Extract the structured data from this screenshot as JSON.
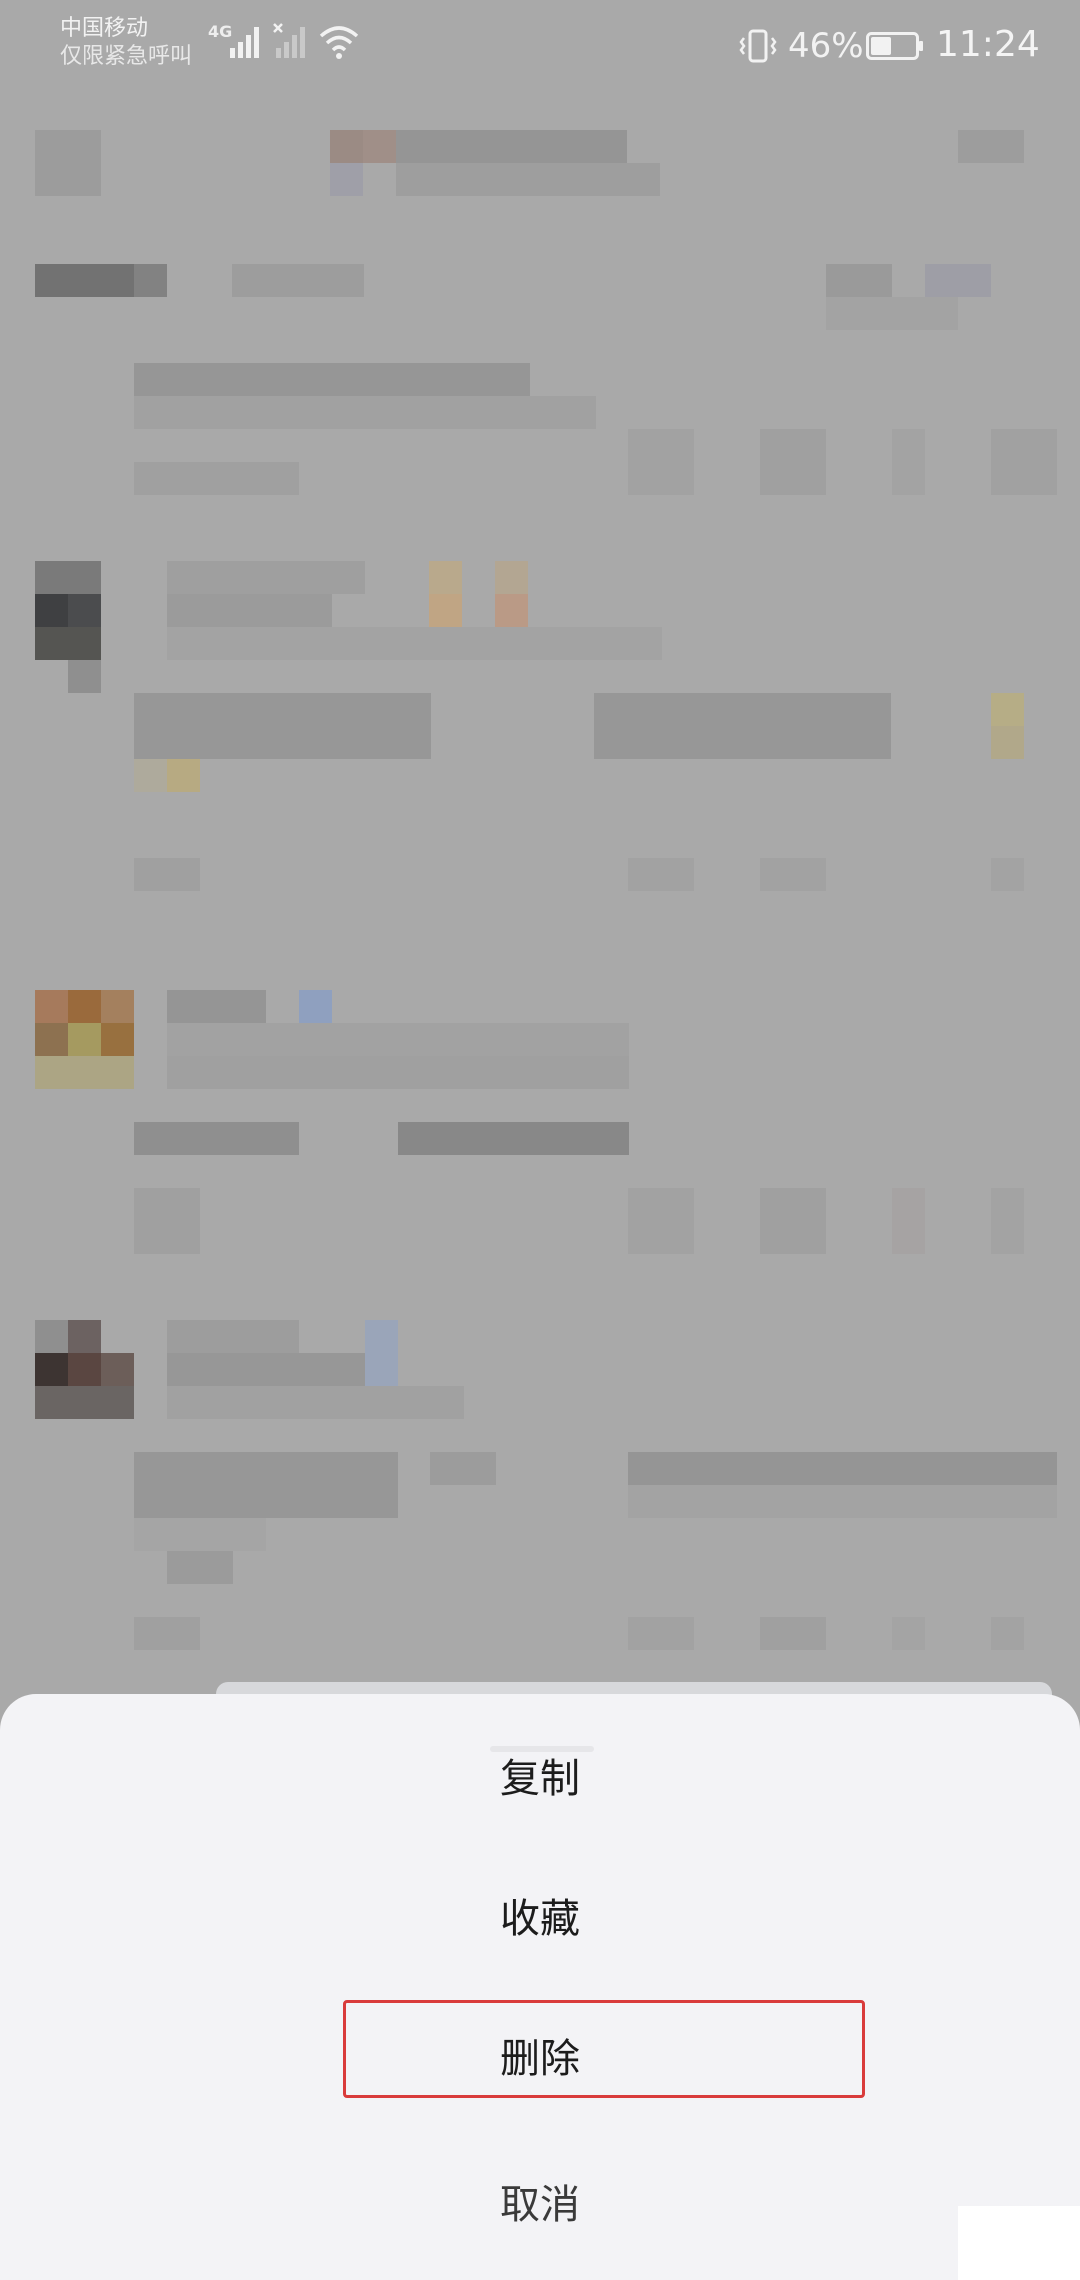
{
  "status_bar": {
    "carrier": "中国移动",
    "carrier_sub": "仅限紧急呼叫",
    "network": "4G",
    "battery_percent": "46%",
    "battery_level": 0.46,
    "time": "11:24",
    "icons": [
      "signal-icon",
      "signal-no-service-icon",
      "wifi-icon",
      "vibrate-icon",
      "battery-icon"
    ]
  },
  "action_sheet": {
    "items": [
      {
        "label": "复制"
      },
      {
        "label": "收藏"
      },
      {
        "label": "删除",
        "highlighted": true
      },
      {
        "label": "取消"
      }
    ]
  },
  "colors": {
    "overlay": "#a9a9a9",
    "sheet": "#f3f3f6",
    "highlight": "#d93b3b"
  }
}
